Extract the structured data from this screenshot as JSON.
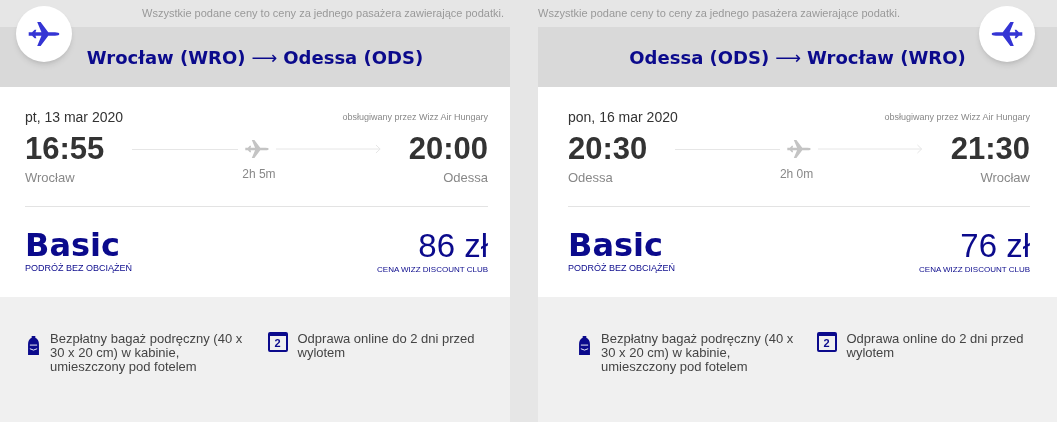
{
  "flights": [
    {
      "notice": "Wszystkie podane ceny to ceny za jednego pasażera zawierające podatki.",
      "outbound": true,
      "route": {
        "origin": "Wrocław (WRO)",
        "arrow": "⟶",
        "destination": "Odessa (ODS)"
      },
      "date": "pt, 13 mar 2020",
      "operator": "obsługiwany przez Wizz Air Hungary",
      "departure": {
        "time": "16:55",
        "city": "Wrocław"
      },
      "duration": "2h 5m",
      "arrival": {
        "time": "20:00",
        "city": "Odessa"
      },
      "fare": {
        "name": "Basic",
        "subtitle": "PODRÓŻ BEZ OBCIĄŻEŃ",
        "price": "86 zł",
        "price_note": "CENA WIZZ DISCOUNT CLUB"
      },
      "features": [
        {
          "kind": "bag",
          "text": "Bezpłatny bagaż podręczny (40 x 30 x 20 cm) w kabinie, umieszczony pod fotelem"
        },
        {
          "kind": "calendar",
          "day": "2",
          "text": "Odprawa online do 2 dni przed wylotem"
        }
      ]
    },
    {
      "notice": "Wszystkie podane ceny to ceny za jednego pasażera zawierające podatki.",
      "outbound": false,
      "route": {
        "origin": "Odessa (ODS)",
        "arrow": "⟶",
        "destination": "Wrocław (WRO)"
      },
      "date": "pon, 16 mar 2020",
      "operator": "obsługiwany przez Wizz Air Hungary",
      "departure": {
        "time": "20:30",
        "city": "Odessa"
      },
      "duration": "2h 0m",
      "arrival": {
        "time": "21:30",
        "city": "Wrocław"
      },
      "fare": {
        "name": "Basic",
        "subtitle": "PODRÓŻ BEZ OBCIĄŻEŃ",
        "price": "76 zł",
        "price_note": "CENA WIZZ DISCOUNT CLUB"
      },
      "features": [
        {
          "kind": "bag",
          "text": "Bezpłatny bagaż podręczny (40 x 30 x 20 cm) w kabinie, umieszczony pod fotelem"
        },
        {
          "kind": "calendar",
          "day": "2",
          "text": "Odprawa online do 2 dni przed wylotem"
        }
      ]
    }
  ]
}
